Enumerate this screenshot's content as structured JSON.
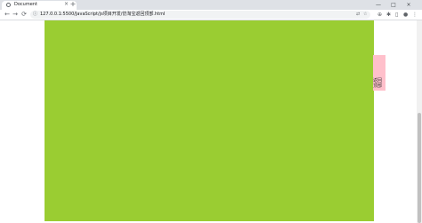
{
  "browser": {
    "tab_title": "Document",
    "tab_close": "×",
    "new_tab": "+",
    "window_controls": {
      "minimize": "—",
      "maximize": "□",
      "close": "×"
    },
    "nav": {
      "back": "←",
      "forward": "→",
      "reload": "⟳"
    },
    "url": "127.0.0.1:5500/JavaScript/js项目开发/仿淘宝返回顶部.html",
    "icons": [
      "info-icon",
      "translate-icon",
      "zoom-icon",
      "star-icon",
      "extensions-icon",
      "sidebar-icon",
      "profile-icon",
      "menu-icon"
    ]
  },
  "page": {
    "colors": {
      "main_box": "#9acd32",
      "side_box": "#ffc0cb"
    },
    "side_box_text": "返回顶部"
  }
}
